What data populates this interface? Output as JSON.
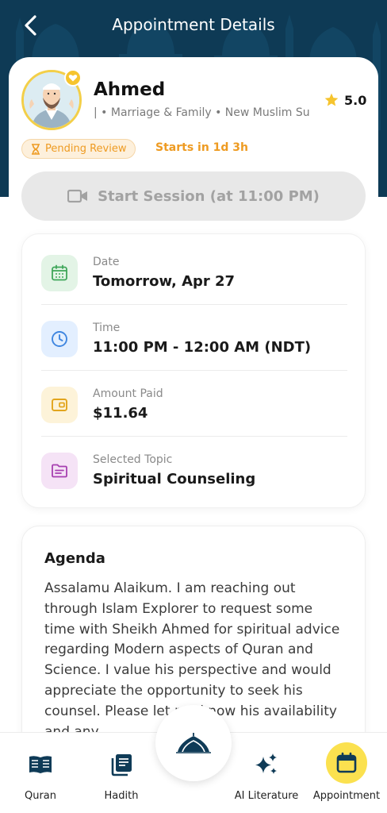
{
  "header": {
    "title": "Appointment Details"
  },
  "scholar": {
    "name": "Ahmed",
    "specialties": "| • Marriage & Family • New Muslim Su",
    "rating": "5.0"
  },
  "status": {
    "badge": "Pending Review",
    "starts_in": "Starts in 1d 3h"
  },
  "start_session": {
    "label": "Start Session (at 11:00 PM)"
  },
  "details": {
    "date": {
      "label": "Date",
      "value": "Tomorrow, Apr 27"
    },
    "time": {
      "label": "Time",
      "value": "11:00 PM - 12:00 AM (NDT)"
    },
    "amount": {
      "label": "Amount Paid",
      "value": "$11.64"
    },
    "topic": {
      "label": "Selected Topic",
      "value": "Spiritual Counseling"
    }
  },
  "agenda": {
    "title": "Agenda",
    "text": "Assalamu Alaikum. I am reaching out through Islam Explorer to request some time with Sheikh Ahmed for spiritual advice regarding Modern aspects of Quran and Science. I value his perspective and would appreciate the opportunity to seek his counsel. Please let me know his availability and any"
  },
  "nav": {
    "quran": "Quran",
    "hadith": "Hadith",
    "ai_literature": "AI Literature",
    "appointment": "Appointment"
  },
  "icons": {
    "back": "chevron-left-icon",
    "favorite": "heart-icon",
    "star": "star-icon",
    "hourglass": "hourglass-icon",
    "video": "video-camera-icon",
    "calendar": "calendar-icon",
    "clock": "clock-icon",
    "wallet": "wallet-icon",
    "topic": "folder-icon",
    "quran": "open-book-icon",
    "hadith": "books-icon",
    "ai": "sparkles-icon",
    "appointment": "calendar-icon",
    "home": "mosque-dome-icon"
  },
  "colors": {
    "header": "#0e3a55",
    "accent_orange": "#ee9b22",
    "active_nav": "#fbe14f",
    "star": "#f6c42e"
  }
}
